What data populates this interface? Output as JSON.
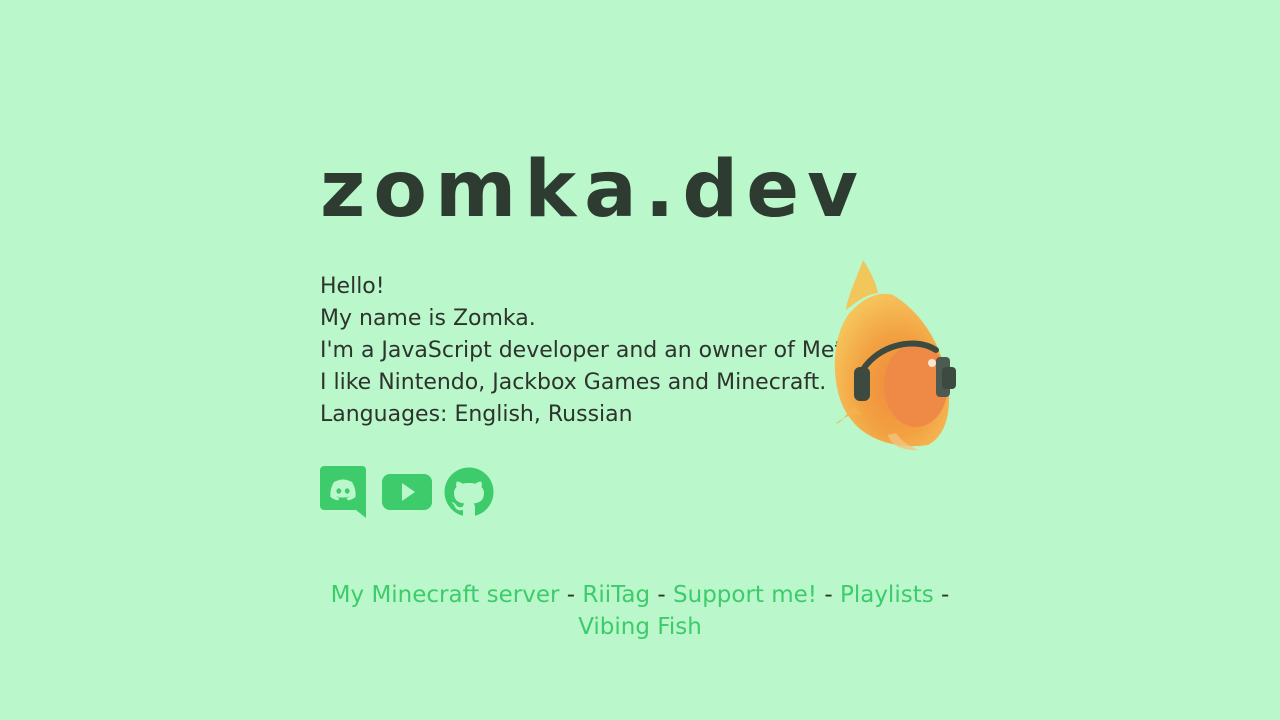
{
  "site": {
    "title": "zomka.dev"
  },
  "intro": {
    "lines": [
      "Hello!",
      "My name is Zomka.",
      "I'm a JavaScript developer and an owner of MetaMC.",
      "I like Nintendo, Jackbox Games and Minecraft.",
      "Languages: English, Russian"
    ]
  },
  "socials": [
    {
      "icon": "discord-icon"
    },
    {
      "icon": "youtube-icon"
    },
    {
      "icon": "github-icon"
    }
  ],
  "footer": {
    "links": [
      "My Minecraft server",
      "RiiTag",
      "Support me!",
      "Playlists",
      "Vibing Fish"
    ],
    "separator": "-"
  },
  "colors": {
    "background": "#baf7cb",
    "accent": "#3dcb6b",
    "text": "#2e342d",
    "title": "#2e3b30"
  }
}
